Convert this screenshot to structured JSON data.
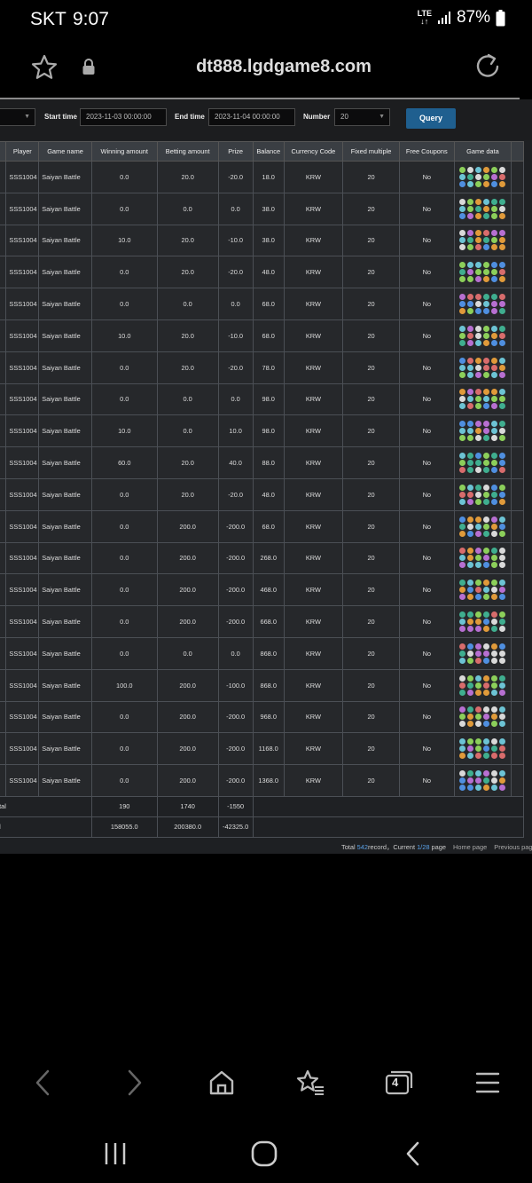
{
  "status_bar": {
    "carrier": "SKT",
    "time": "9:07",
    "network": "LTE",
    "battery": "87%"
  },
  "browser": {
    "url": "dt888.lgdgame8.com",
    "tab_count": "4"
  },
  "filters": {
    "start_label": "Start time",
    "start_value": "2023-11-03 00:00:00",
    "end_label": "End time",
    "end_value": "2023-11-04 00:00:00",
    "number_label": "Number",
    "number_value": "20",
    "query_label": "Query"
  },
  "table": {
    "headers": [
      "Player",
      "Game name",
      "Winning amount",
      "Betting amount",
      "Prize",
      "Balance",
      "Currency Code",
      "Fixed multiple",
      "Free Coupons",
      "Game data"
    ],
    "rows": [
      [
        "SSS1004",
        "Saiyan Battle",
        "0.0",
        "20.0",
        "-20.0",
        "18.0",
        "KRW",
        "20",
        "No"
      ],
      [
        "SSS1004",
        "Saiyan Battle",
        "0.0",
        "0.0",
        "0.0",
        "38.0",
        "KRW",
        "20",
        "No"
      ],
      [
        "SSS1004",
        "Saiyan Battle",
        "10.0",
        "20.0",
        "-10.0",
        "38.0",
        "KRW",
        "20",
        "No"
      ],
      [
        "SSS1004",
        "Saiyan Battle",
        "0.0",
        "20.0",
        "-20.0",
        "48.0",
        "KRW",
        "20",
        "No"
      ],
      [
        "SSS1004",
        "Saiyan Battle",
        "0.0",
        "0.0",
        "0.0",
        "68.0",
        "KRW",
        "20",
        "No"
      ],
      [
        "SSS1004",
        "Saiyan Battle",
        "10.0",
        "20.0",
        "-10.0",
        "68.0",
        "KRW",
        "20",
        "No"
      ],
      [
        "SSS1004",
        "Saiyan Battle",
        "0.0",
        "20.0",
        "-20.0",
        "78.0",
        "KRW",
        "20",
        "No"
      ],
      [
        "SSS1004",
        "Saiyan Battle",
        "0.0",
        "0.0",
        "0.0",
        "98.0",
        "KRW",
        "20",
        "No"
      ],
      [
        "SSS1004",
        "Saiyan Battle",
        "10.0",
        "0.0",
        "10.0",
        "98.0",
        "KRW",
        "20",
        "No"
      ],
      [
        "SSS1004",
        "Saiyan Battle",
        "60.0",
        "20.0",
        "40.0",
        "88.0",
        "KRW",
        "20",
        "No"
      ],
      [
        "SSS1004",
        "Saiyan Battle",
        "0.0",
        "20.0",
        "-20.0",
        "48.0",
        "KRW",
        "20",
        "No"
      ],
      [
        "SSS1004",
        "Saiyan Battle",
        "0.0",
        "200.0",
        "-200.0",
        "68.0",
        "KRW",
        "20",
        "No"
      ],
      [
        "SSS1004",
        "Saiyan Battle",
        "0.0",
        "200.0",
        "-200.0",
        "268.0",
        "KRW",
        "20",
        "No"
      ],
      [
        "SSS1004",
        "Saiyan Battle",
        "0.0",
        "200.0",
        "-200.0",
        "468.0",
        "KRW",
        "20",
        "No"
      ],
      [
        "SSS1004",
        "Saiyan Battle",
        "0.0",
        "200.0",
        "-200.0",
        "668.0",
        "KRW",
        "20",
        "No"
      ],
      [
        "SSS1004",
        "Saiyan Battle",
        "0.0",
        "0.0",
        "0.0",
        "868.0",
        "KRW",
        "20",
        "No"
      ],
      [
        "SSS1004",
        "Saiyan Battle",
        "100.0",
        "200.0",
        "-100.0",
        "868.0",
        "KRW",
        "20",
        "No"
      ],
      [
        "SSS1004",
        "Saiyan Battle",
        "0.0",
        "200.0",
        "-200.0",
        "968.0",
        "KRW",
        "20",
        "No"
      ],
      [
        "SSS1004",
        "Saiyan Battle",
        "0.0",
        "200.0",
        "-200.0",
        "1168.0",
        "KRW",
        "20",
        "No"
      ],
      [
        "SSS1004",
        "Saiyan Battle",
        "0.0",
        "200.0",
        "-200.0",
        "1368.0",
        "KRW",
        "20",
        "No"
      ]
    ],
    "subtotal": {
      "label": "otal",
      "winning": "190",
      "betting": "1740",
      "prize": "-1550"
    },
    "total": {
      "label": "al",
      "winning": "158055.0",
      "betting": "200380.0",
      "prize": "-42325.0"
    }
  },
  "pagination": {
    "prefix": "Total ",
    "total": "542",
    "mid": "record，Current ",
    "current": "1/28",
    "suffix": " page",
    "home": "Home page",
    "previous": "Previous page"
  },
  "icon_colors": [
    "#6cc3d4",
    "#e09a3a",
    "#b76fd1",
    "#8ccf5a",
    "#d9d9d9",
    "#4f8fe0",
    "#d86c6c",
    "#3fae8f"
  ]
}
